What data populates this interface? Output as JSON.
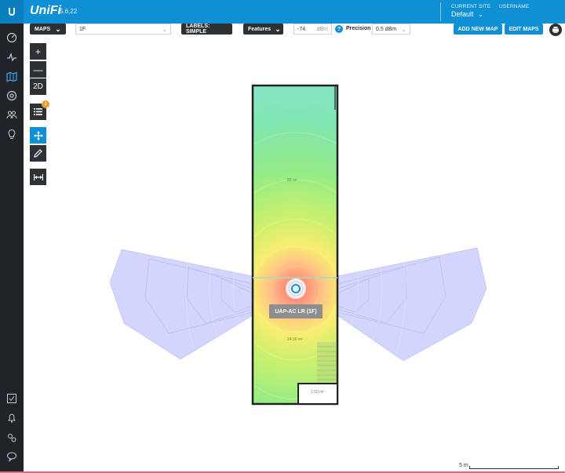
{
  "header": {
    "brand": "UniFi",
    "version": "5.6.22",
    "current_site_label": "CURRENT SITE",
    "current_site_value": "Default",
    "username_label": "USERNAME"
  },
  "toolbar": {
    "maps_label": "MAPS",
    "floor_select": "1F",
    "labels_button": "LABELS: SIMPLE",
    "features_button": "Features",
    "signal_value": "-74",
    "signal_unit": "dBm",
    "precision_label": "Precision",
    "precision_value": "0.5 dBm",
    "add_map_button": "ADD NEW MAP",
    "edit_maps_button": "EDIT MAPS"
  },
  "tools": {
    "zoom_in": "+",
    "zoom_out": "—",
    "view_mode": "2D",
    "list_badge": "1"
  },
  "map": {
    "ap_label": "UAP-AC LR (1F)",
    "room_upper_area": "85 m²",
    "room_lower_area": "24.00 m²",
    "room_small_area": "1.50 m²",
    "scale_label": "5 m"
  },
  "colors": {
    "topbar": "#0f8fd4",
    "leftnav": "#1f2429",
    "accent_blue": "#0f8fd4",
    "heat_green": "#8fe88a",
    "heat_yellow": "#f6ef6a",
    "heat_red": "#ff8a7a",
    "coverage_lobe": "#c9ccf5"
  }
}
